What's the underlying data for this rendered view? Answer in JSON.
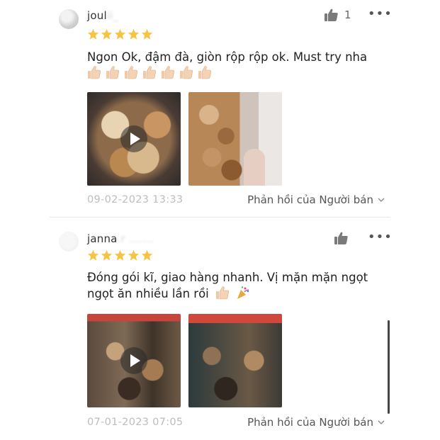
{
  "reviews": [
    {
      "username": "joul",
      "username_hidden": "ii_",
      "likes": "1",
      "stars": 5,
      "comment": "Ngon Ok, đậm đà, giòn rộp rộp ok. Must try nha",
      "emoji_thumbs_count": 7,
      "media": [
        "video",
        "image"
      ],
      "date": "09-02-2023 13:33",
      "seller_reply_label": "Phản hồi của Người bán"
    },
    {
      "username": "janna",
      "username_hidden": ".r .......",
      "likes": "",
      "stars": 5,
      "comment": "Đóng gói kĩ, giao hàng nhanh. Vị mặn mặn ngọt ngọt ăn nhiều lần rồi",
      "media": [
        "video",
        "image"
      ],
      "date": "07-01-2023 07:05",
      "seller_reply_label": "Phản hồi của Người bán"
    }
  ],
  "colors": {
    "star": "#f6c343",
    "date_text": "#bdbdbd",
    "divider": "#e6e6e6"
  },
  "icons": {
    "like": "thumbs-up-icon",
    "more": "more-icon",
    "play": "play-icon",
    "chevron": "chevron-down-icon",
    "emoji_thumb": "thumbs-up-emoji",
    "emoji_party": "party-popper-emoji"
  }
}
